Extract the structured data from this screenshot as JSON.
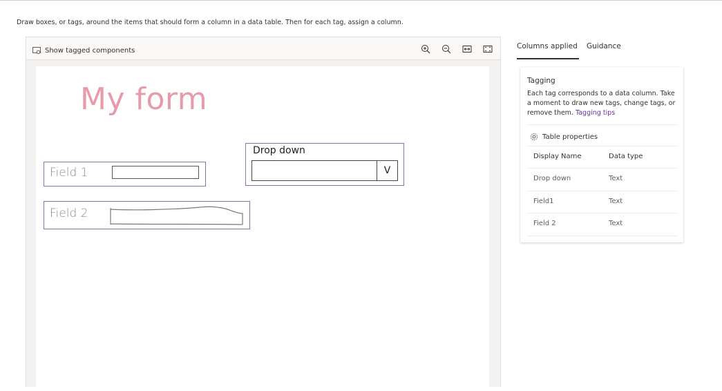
{
  "instruction": "Draw boxes, or tags, around the items that should form a column in a data table. Then for each tag, assign a column.",
  "toolbar": {
    "show_tagged_label": "Show tagged components",
    "icons": [
      "zoom-in-icon",
      "zoom-out-icon",
      "fit-width-icon",
      "fit-page-icon"
    ]
  },
  "document": {
    "form_title": "My form",
    "dropdown_label": "Drop down",
    "dropdown_chevron": "V",
    "field1_label": "Field 1",
    "field2_label": "Field 2"
  },
  "tabs": [
    {
      "label": "Columns applied",
      "active": true
    },
    {
      "label": "Guidance",
      "active": false
    }
  ],
  "card": {
    "title": "Tagging",
    "description": "Each tag corresponds to a data column. Take a moment to draw new tags, change tags, or remove them.",
    "link_text": "Tagging tips",
    "table_properties": "Table properties",
    "columns": [
      "Display Name",
      "Data type"
    ],
    "rows": [
      {
        "name": "Drop down",
        "type": "Text"
      },
      {
        "name": "Field1",
        "type": "Text"
      },
      {
        "name": "Field 2",
        "type": "Text"
      }
    ]
  },
  "colors": {
    "accent": "#6b2fa0",
    "tag_border": "#7b78b6",
    "form_title": "#e79aaa"
  }
}
